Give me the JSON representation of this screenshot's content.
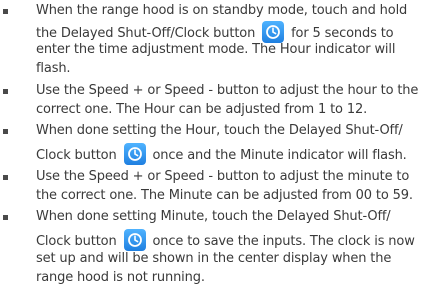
{
  "instructions": [
    {
      "lines": [
        {
          "before": "When the range hood is on standby mode, touch and hold"
        },
        {
          "before": "the Delayed Shut-Off/Clock button ",
          "icon": "clock-icon",
          "after": " for 5 seconds to"
        },
        {
          "before": "enter the time adjustment mode. The Hour indicator will"
        },
        {
          "before": "flash."
        }
      ]
    },
    {
      "lines": [
        {
          "before": "Use the Speed + or Speed - button to adjust the hour to the"
        },
        {
          "before": "correct one. The Hour can be adjusted from 1 to 12."
        }
      ]
    },
    {
      "lines": [
        {
          "before": "When done setting the Hour, touch the Delayed Shut-Off/"
        },
        {
          "before": "Clock button ",
          "icon": "clock-icon",
          "after": " once and the Minute indicator will flash."
        }
      ]
    },
    {
      "lines": [
        {
          "before": "Use the Speed + or Speed - button to adjust the minute to"
        },
        {
          "before": "the correct one. The Minute can be adjusted from 00 to 59."
        }
      ]
    },
    {
      "lines": [
        {
          "before": "When done setting Minute, touch the Delayed Shut-Off/"
        },
        {
          "before": "Clock button ",
          "icon": "clock-icon",
          "after": " once to save the inputs. The clock is now"
        },
        {
          "before": "set up and will be shown in the center display when the"
        },
        {
          "before": "range hood is not running."
        }
      ]
    }
  ],
  "colors": {
    "text": "#3a3a3a",
    "icon_top": "#4fb3ff",
    "icon_bottom": "#1f7fe0"
  }
}
